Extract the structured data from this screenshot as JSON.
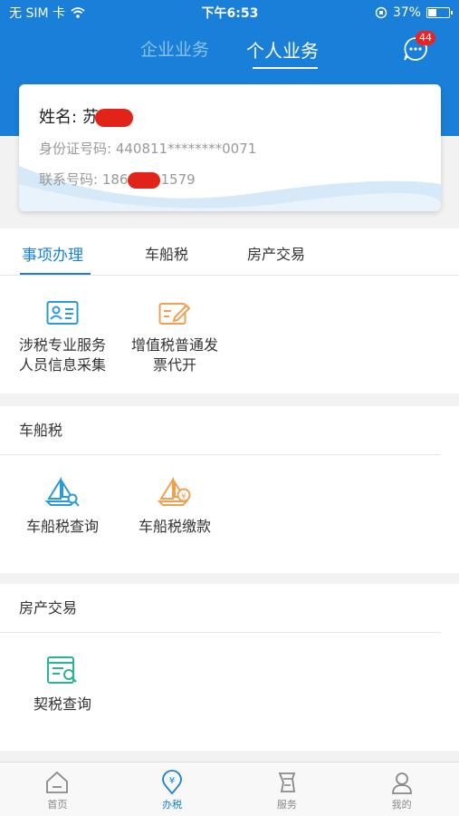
{
  "status_bar": {
    "carrier": "无 SIM 卡",
    "time": "下午6:53",
    "battery": "37%",
    "battery_level": 0.37
  },
  "header": {
    "tabs": [
      "企业业务",
      "个人业务"
    ],
    "message_badge": "44"
  },
  "card": {
    "name_label": "姓名:",
    "name_value": "苏",
    "id_label": "身份证号码:",
    "id_value": "440811********0071",
    "phone_label": "联系号码:",
    "phone_prefix": "186",
    "phone_suffix": "1579"
  },
  "tabs": [
    "事项办理",
    "车船税",
    "房产交易"
  ],
  "items_section": {
    "items": [
      {
        "icon": "id-card-icon",
        "label_line1": "涉税专业服务",
        "label_line2": "人员信息采集"
      },
      {
        "icon": "edit-invoice-icon",
        "label_line1": "增值税普通发",
        "label_line2": "票代开"
      }
    ]
  },
  "vessel_section": {
    "title": "车船税",
    "items": [
      {
        "icon": "sailboat-search-icon",
        "label": "车船税查询"
      },
      {
        "icon": "sailboat-pay-icon",
        "label": "车船税缴款"
      }
    ]
  },
  "property_section": {
    "title": "房产交易",
    "items": [
      {
        "icon": "document-search-icon",
        "label": "契税查询"
      }
    ]
  },
  "bottom_nav": [
    {
      "icon": "home-icon",
      "label": "首页"
    },
    {
      "icon": "tax-location-icon",
      "label": "办税"
    },
    {
      "icon": "service-icon",
      "label": "服务"
    },
    {
      "icon": "user-icon",
      "label": "我的"
    }
  ],
  "colors": {
    "brand": "#1a7fd8",
    "badge": "#e22222",
    "orange": "#f0a050",
    "teal": "#2bb39a"
  }
}
